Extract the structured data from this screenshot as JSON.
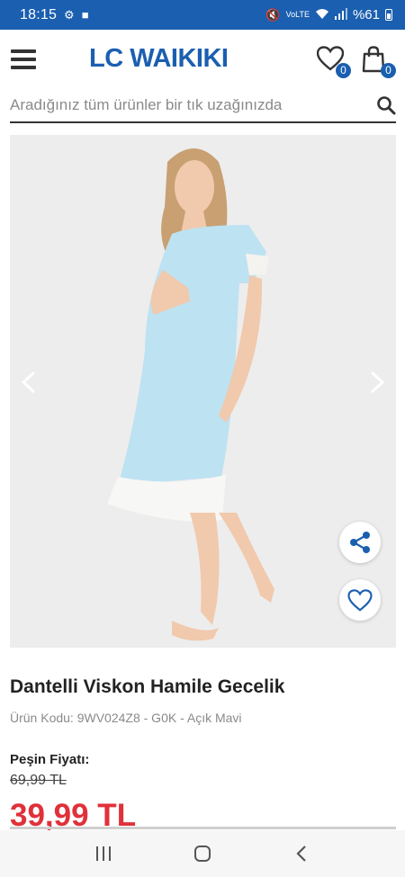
{
  "status_bar": {
    "time": "18:15",
    "battery": "%61"
  },
  "header": {
    "logo": "LC WAIKIKI",
    "favorites_count": "0",
    "cart_count": "0"
  },
  "search": {
    "placeholder": "Aradığınız tüm ürünler bir tık uzağınızda"
  },
  "product": {
    "title": "Dantelli Viskon Hamile Gecelik",
    "code": "Ürün Kodu: 9WV024Z8 - G0K - Açık Mavi",
    "price_label": "Peşin Fiyatı:",
    "old_price": "69,99 TL",
    "new_price": "39,99 TL"
  },
  "colors": {
    "brand": "#1b5fb0",
    "price": "#e0313a"
  }
}
